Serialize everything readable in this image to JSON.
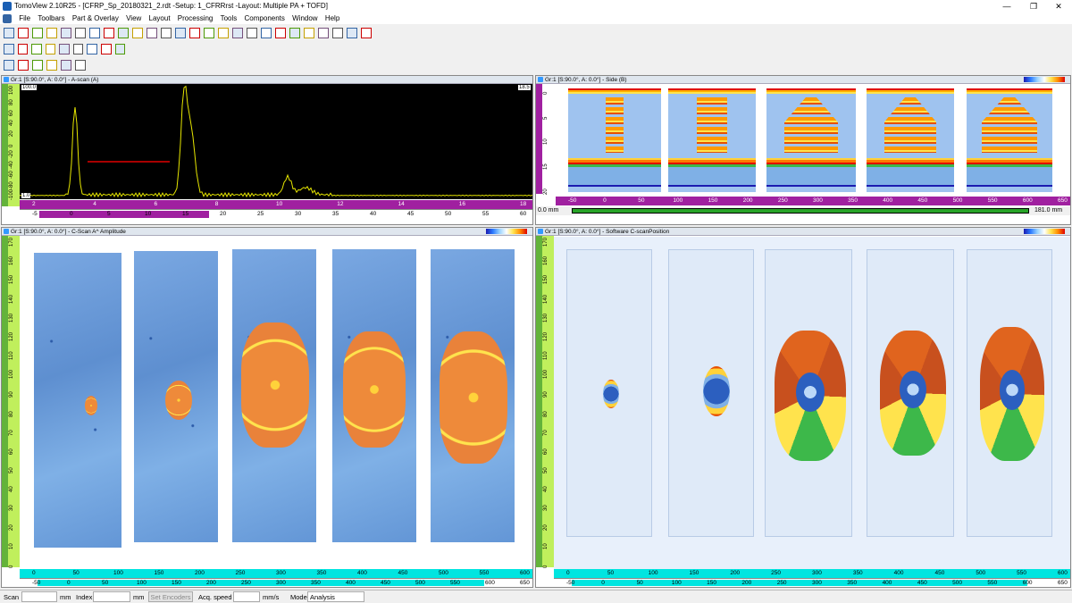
{
  "window": {
    "title": "TomoView 2.10R25 - [CFRP_Sp_20180321_2.rdt -Setup: 1_CFRRrst -Layout: Multiple PA + TOFD]",
    "min": "—",
    "restore": "❐",
    "close": "✕"
  },
  "menu": [
    "File",
    "Toolbars",
    "Part & Overlay",
    "View",
    "Layout",
    "Processing",
    "Tools",
    "Components",
    "Window",
    "Help"
  ],
  "panels": {
    "ascan": {
      "title": "Gr:1 [S:90.0°, A: 0.0°] - A-scan (A)",
      "top_value": "100.0",
      "right_value": "18.5",
      "bottom_value": "-100",
      "left_marker": "1.0",
      "vticks": [
        "100",
        "80",
        "60",
        "40",
        "20",
        "0",
        "-20",
        "-40",
        "-60",
        "-80",
        "-100"
      ],
      "hticks_top": [
        "2",
        "4",
        "6",
        "8",
        "10",
        "12",
        "14",
        "16",
        "18"
      ],
      "hticks_bottom": [
        "-5",
        "0",
        "5",
        "10",
        "15",
        "20",
        "25",
        "30",
        "35",
        "40",
        "45",
        "50",
        "55",
        "60"
      ]
    },
    "side": {
      "title": "Gr:1 [S:90.0°, A: 0.0°] - Side (B)",
      "vticks": [
        "0",
        "5",
        "10",
        "15",
        "20"
      ],
      "hticks": [
        "-50",
        "0",
        "50",
        "100",
        "150",
        "200",
        "250",
        "300",
        "350",
        "400",
        "450",
        "500",
        "550",
        "600",
        "650"
      ],
      "range_start": "0.0 mm",
      "range_end": "181.0 mm"
    },
    "cscan": {
      "title": "Gr:1 [S:90.0°, A: 0.0°] - C-Scan A^ Amplitude",
      "vticks": [
        "170",
        "160",
        "150",
        "140",
        "130",
        "120",
        "110",
        "100",
        "90",
        "80",
        "70",
        "60",
        "50",
        "40",
        "30",
        "20",
        "10",
        "0"
      ],
      "hticks_top_unit": "mm",
      "hticks_top": [
        "0",
        "50",
        "100",
        "150",
        "200",
        "250",
        "300",
        "350",
        "400",
        "450",
        "500",
        "550",
        "600"
      ],
      "hticks_bottom": [
        "-50",
        "0",
        "50",
        "100",
        "150",
        "200",
        "250",
        "300",
        "350",
        "400",
        "450",
        "500",
        "550",
        "600",
        "650"
      ]
    },
    "cpos": {
      "title": "Gr:1 [S:90.0°, A: 0.0°] - Software C-scanPosition",
      "vticks": [
        "170",
        "160",
        "150",
        "140",
        "130",
        "120",
        "110",
        "100",
        "90",
        "80",
        "70",
        "60",
        "50",
        "40",
        "30",
        "20",
        "10",
        "0"
      ],
      "hticks_top_unit": "mm",
      "hticks_top": [
        "0",
        "50",
        "100",
        "150",
        "200",
        "250",
        "300",
        "350",
        "400",
        "450",
        "500",
        "550",
        "600"
      ],
      "hticks_bottom": [
        "-50",
        "0",
        "50",
        "100",
        "150",
        "200",
        "250",
        "300",
        "350",
        "400",
        "450",
        "500",
        "550",
        "600",
        "650"
      ]
    }
  },
  "status": {
    "scan_label": "Scan",
    "scan_unit": "mm",
    "index_label": "Index",
    "index_unit": "mm",
    "set_encoders": "Set Encoders",
    "acq_speed_label": "Acq. speed",
    "acq_speed_unit": "mm/s",
    "mode_label": "Mode",
    "mode_value": "Analysis"
  },
  "colors": {
    "ruler_green": "#63b33a",
    "ruler_lime": "#c0ef5c",
    "ruler_purple": "#a020a0",
    "ruler_cyan": "#00e5e0",
    "signal_yellow": "#e6e600",
    "gate_red": "#e00000"
  }
}
